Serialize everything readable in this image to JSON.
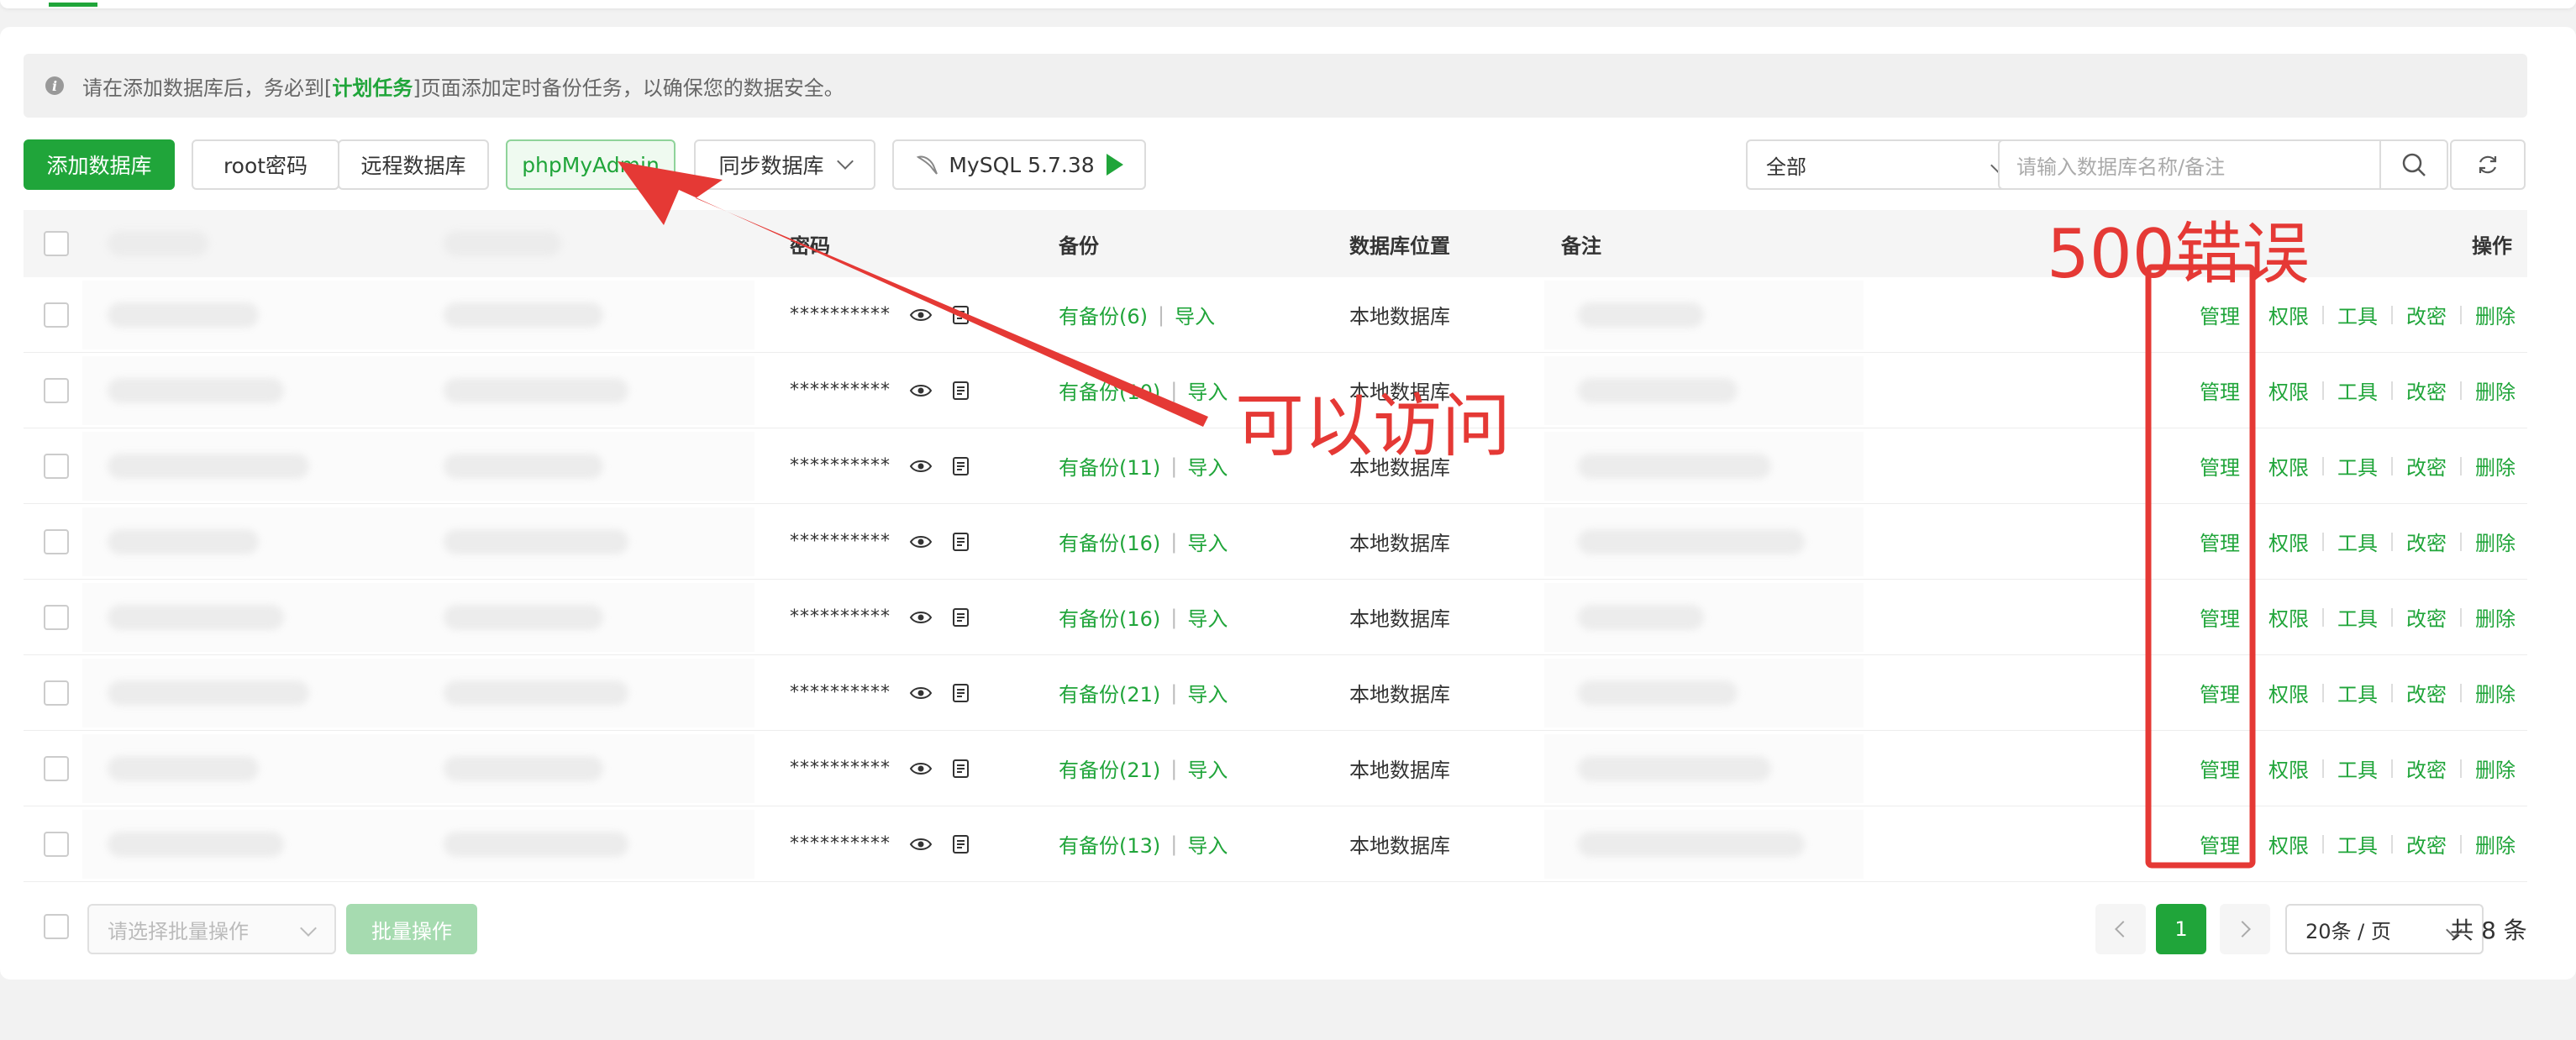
{
  "notice": {
    "prefix": "请在添加数据库后，务必到[",
    "link": "计划任务",
    "suffix": "]页面添加定时备份任务，以确保您的数据安全。"
  },
  "toolbar": {
    "add_db": "添加数据库",
    "root_pw": "root密码",
    "remote_db": "远程数据库",
    "phpmyadmin": "phpMyAdmin",
    "sync_db": "同步数据库",
    "mysql_version": "MySQL 5.7.38"
  },
  "filter": {
    "selected": "全部"
  },
  "search": {
    "placeholder": "请输入数据库名称/备注"
  },
  "table": {
    "headers": {
      "password": "密码",
      "backup": "备份",
      "location": "数据库位置",
      "remark": "备注",
      "actions": "操作"
    },
    "rows": [
      {
        "password": "**********",
        "backup": "有备份(6)",
        "import": "导入",
        "location": "本地数据库"
      },
      {
        "password": "**********",
        "backup": "有备份(10)",
        "import": "导入",
        "location": "本地数据库"
      },
      {
        "password": "**********",
        "backup": "有备份(11)",
        "import": "导入",
        "location": "本地数据库"
      },
      {
        "password": "**********",
        "backup": "有备份(16)",
        "import": "导入",
        "location": "本地数据库"
      },
      {
        "password": "**********",
        "backup": "有备份(16)",
        "import": "导入",
        "location": "本地数据库"
      },
      {
        "password": "**********",
        "backup": "有备份(21)",
        "import": "导入",
        "location": "本地数据库"
      },
      {
        "password": "**********",
        "backup": "有备份(21)",
        "import": "导入",
        "location": "本地数据库"
      },
      {
        "password": "**********",
        "backup": "有备份(13)",
        "import": "导入",
        "location": "本地数据库"
      }
    ],
    "actions": {
      "manage": "管理",
      "perms": "权限",
      "tools": "工具",
      "change_pw": "改密",
      "delete": "删除"
    }
  },
  "footer": {
    "batch_placeholder": "请选择批量操作",
    "batch_button": "批量操作",
    "page": "1",
    "page_size": "20条 / 页",
    "total": "共 8 条"
  },
  "annotations": {
    "error_label": "500错误",
    "ok_label": "可以访问",
    "color": "#e53935"
  },
  "colors": {
    "accent": "#20a53a"
  }
}
